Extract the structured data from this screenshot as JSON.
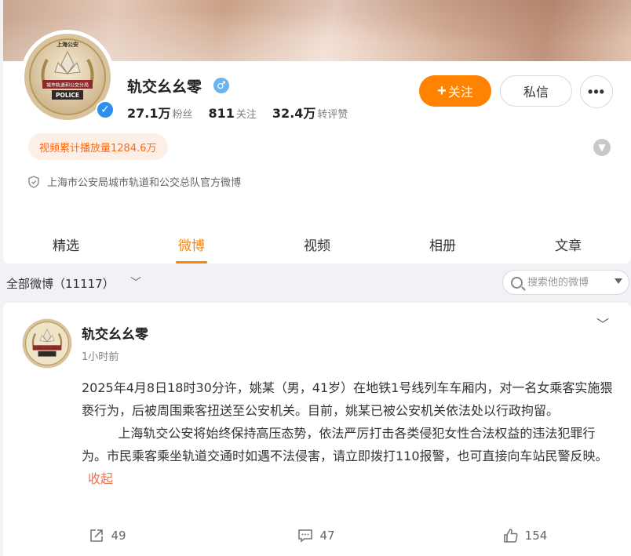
{
  "profile": {
    "name": "轨交幺幺零",
    "gender_icon": "male-icon",
    "stats": [
      {
        "value": "27.1万",
        "label": "粉丝"
      },
      {
        "value": "811",
        "label": "关注"
      },
      {
        "value": "32.4万",
        "label": "转评赞"
      }
    ],
    "follow_plus": "+",
    "follow_label": "关注",
    "message_label": "私信",
    "more_label": "•••",
    "play_count": "视频累计播放量1284.6万",
    "verified_text": "上海市公安局城市轨道和公交总队官方微博",
    "logo_texts": {
      "top": "上海公安",
      "band": "城市轨道和公交分局",
      "police": "POLICE"
    }
  },
  "tabs": [
    {
      "label": "精选",
      "active": false
    },
    {
      "label": "微博",
      "active": true
    },
    {
      "label": "视频",
      "active": false
    },
    {
      "label": "相册",
      "active": false
    },
    {
      "label": "文章",
      "active": false
    }
  ],
  "filter": {
    "label": "全部微博（11117）",
    "chevron": "﹀",
    "search_placeholder": "搜索他的微博"
  },
  "post": {
    "author": "轨交幺幺零",
    "time": "1小时前",
    "menu_chevron": "﹀",
    "paragraph1": "2025年4月8日18时30分许，姚某（男，41岁）在地铁1号线列车车厢内，对一名女乘客实施猥亵行为，后被周围乘客扭送至公安机关。目前，姚某已被公安机关依法处以行政拘留。",
    "paragraph2": "上海轨交公安将始终保持高压态势，依法严厉打击各类侵犯女性合法权益的违法犯罪行为。市民乘客乘坐轨道交通时如遇不法侵害，请立即拨打110报警，也可直接向车站民警反映。",
    "collapse_label": "收起",
    "actions": [
      {
        "icon": "share-icon",
        "count": "49"
      },
      {
        "icon": "comment-icon",
        "count": "47"
      },
      {
        "icon": "like-icon",
        "count": "154"
      }
    ]
  },
  "colors": {
    "accent": "#ff8200",
    "verify_blue": "#2e8ff0",
    "play_badge_text": "#ff6a13",
    "link": "#eb7350"
  }
}
